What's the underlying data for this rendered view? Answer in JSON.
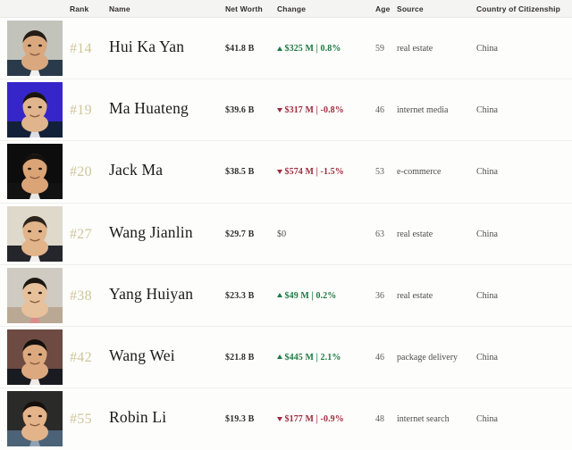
{
  "table": {
    "columns": {
      "rank": "Rank",
      "name": "Name",
      "net_worth": "Net Worth",
      "change": "Change",
      "age": "Age",
      "source": "Source",
      "country": "Country of Citizenship"
    },
    "colors": {
      "header_bg": "#f4f4f3",
      "row_bg": "#fdfdfc",
      "rank_accent": "#cfc69a",
      "change_up": "#1d7a41",
      "change_down": "#9e2b3c",
      "divider": "#efefed"
    },
    "rows": [
      {
        "rank": "#14",
        "name": "Hui Ka Yan",
        "net_worth": "$41.8 B",
        "change": "$325 M | 0.8%",
        "change_direction": "up",
        "age": "59",
        "source": "real estate",
        "country": "China",
        "photo": {
          "name": "portrait-hui-ka-yan",
          "bg": "#c2c3bb",
          "skin": "#d9a87e",
          "hair": "#241c17",
          "clothing": "#2b3a4a",
          "shirt": "#f0f0ee"
        }
      },
      {
        "rank": "#19",
        "name": "Ma Huateng",
        "net_worth": "$39.6 B",
        "change": "$317 M | -0.8%",
        "change_direction": "down",
        "age": "46",
        "source": "internet media",
        "country": "China",
        "photo": {
          "name": "portrait-ma-huateng",
          "bg": "#3626c9",
          "skin": "#e0b48c",
          "hair": "#1a1410",
          "clothing": "#132039",
          "shirt": "#dcdce4"
        }
      },
      {
        "rank": "#20",
        "name": "Jack Ma",
        "net_worth": "$38.5 B",
        "change": "$574 M | -1.5%",
        "change_direction": "down",
        "age": "53",
        "source": "e-commerce",
        "country": "China",
        "photo": {
          "name": "portrait-jack-ma",
          "bg": "#0d0d0d",
          "skin": "#dba476",
          "hair": "#17120e",
          "clothing": "#121212",
          "shirt": "#e8e6e2"
        }
      },
      {
        "rank": "#27",
        "name": "Wang Jianlin",
        "net_worth": "$29.7 B",
        "change": "$0",
        "change_direction": "flat",
        "age": "63",
        "source": "real estate",
        "country": "China",
        "photo": {
          "name": "portrait-wang-jianlin",
          "bg": "#ded9cb",
          "skin": "#e2b48a",
          "hair": "#2b241d",
          "clothing": "#24262b",
          "shirt": "#f2f0ec"
        }
      },
      {
        "rank": "#38",
        "name": "Yang Huiyan",
        "net_worth": "$23.3 B",
        "change": "$49 M | 0.2%",
        "change_direction": "up",
        "age": "36",
        "source": "real estate",
        "country": "China",
        "photo": {
          "name": "portrait-yang-huiyan",
          "bg": "#cfcbc2",
          "skin": "#e7c19c",
          "hair": "#1d1713",
          "clothing": "#b9a894",
          "shirt": "#d98e8a"
        }
      },
      {
        "rank": "#42",
        "name": "Wang Wei",
        "net_worth": "$21.8 B",
        "change": "$445 M | 2.1%",
        "change_direction": "up",
        "age": "46",
        "source": "package delivery",
        "country": "China",
        "photo": {
          "name": "portrait-wang-wei",
          "bg": "#6d4a42",
          "skin": "#dca97f",
          "hair": "#140f0c",
          "clothing": "#191b20",
          "shirt": "#efe9e4"
        }
      },
      {
        "rank": "#55",
        "name": "Robin Li",
        "net_worth": "$19.3 B",
        "change": "$177 M | -0.9%",
        "change_direction": "down",
        "age": "48",
        "source": "internet search",
        "country": "China",
        "photo": {
          "name": "portrait-robin-li",
          "bg": "#2a2a28",
          "skin": "#e3b389",
          "hair": "#15100d",
          "clothing": "#4c6276",
          "shirt": "#8fa3b4"
        }
      }
    ]
  }
}
